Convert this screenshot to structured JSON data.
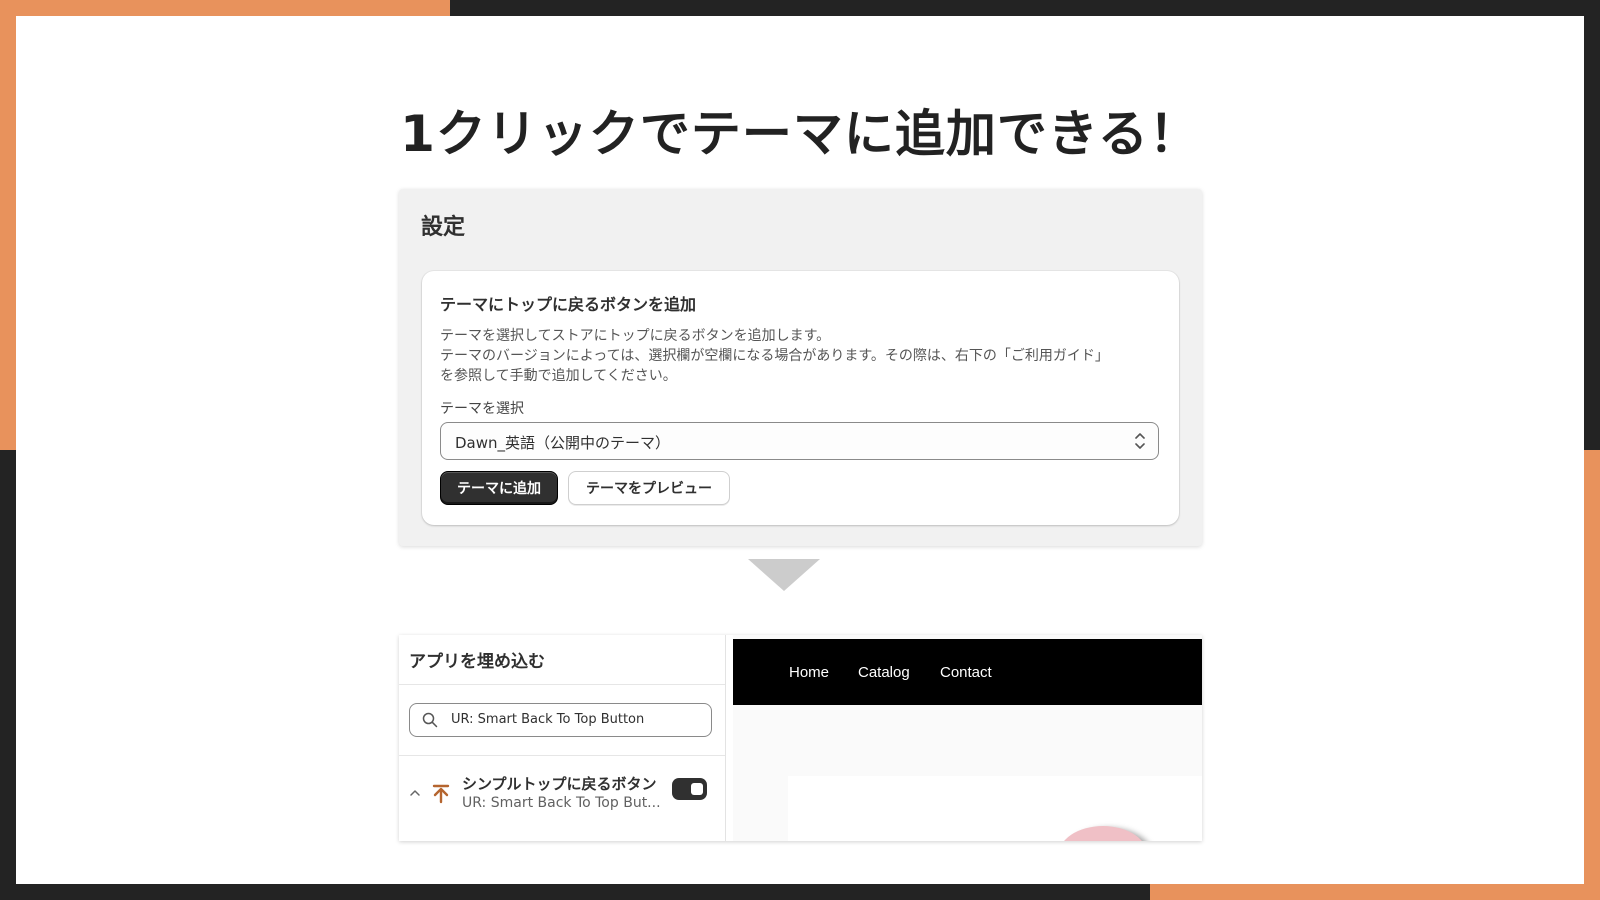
{
  "slide": {
    "title": "1クリックでテーマに追加できる！"
  },
  "settings": {
    "title": "設定",
    "card": {
      "heading": "テーマにトップに戻るボタンを追加",
      "description": [
        "テーマを選択してストアにトップに戻るボタンを追加します。",
        "テーマのバージョンによっては、選択欄が空欄になる場合があります。その際は、右下の「ご利用ガイド」",
        "を参照して手動で追加してください。"
      ],
      "select_label": "テーマを選択",
      "select_value": "Dawn_英語（公開中のテーマ）",
      "add_button": "テーマに追加",
      "preview_button": "テーマをプレビュー"
    }
  },
  "embed": {
    "title": "アプリを埋め込む",
    "search_value": "UR: Smart Back To Top Button",
    "app": {
      "name": "シンプルトップに戻るボタン",
      "subtitle": "UR: Smart Back To Top But...",
      "icon": "arrow-up-to-line-icon",
      "enabled": true
    },
    "store_nav": [
      "Home",
      "Catalog",
      "Contact"
    ]
  },
  "colors": {
    "accent_orange": "#E8925C",
    "frame_dark": "#232323",
    "button_dark": "#303030"
  }
}
